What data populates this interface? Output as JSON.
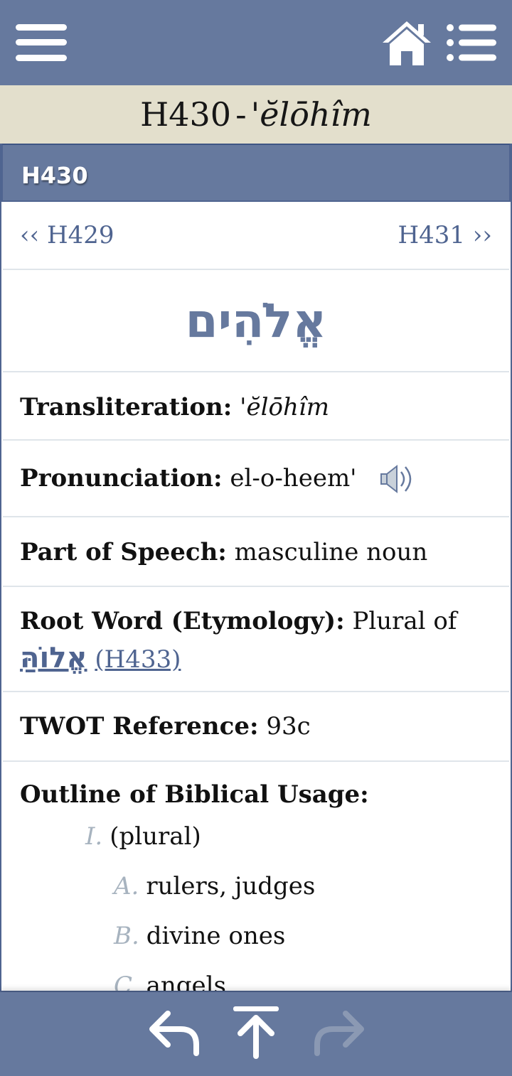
{
  "header": {
    "menu_icon": "hamburger-menu-icon",
    "home_icon": "home-icon",
    "list_icon": "list-icon"
  },
  "title": {
    "code": "H430",
    "separator": "-",
    "translit": "'ĕlōhîm"
  },
  "panel": {
    "header": "H430"
  },
  "nav": {
    "prev": "‹‹ H429",
    "next": "H431 ››"
  },
  "entry": {
    "hebrew": "אֱלֹהִים",
    "transliteration_label": "Transliteration:",
    "transliteration_value": "'ĕlōhîm",
    "pronunciation_label": "Pronunciation:",
    "pronunciation_value": "el-o-heem'",
    "speaker_icon": "speaker-icon",
    "pos_label": "Part of Speech:",
    "pos_value": "masculine noun",
    "root_label": "Root Word (Etymology):",
    "root_text": "Plural of",
    "root_hebrew": "אֱלוֹהַּ",
    "root_ref": "(H433)",
    "twot_label": "TWOT Reference:",
    "twot_value": "93c",
    "outline_label": "Outline of Biblical Usage:",
    "outline": [
      {
        "marker": "I.",
        "text": "(plural)"
      },
      {
        "marker": "A.",
        "text": "rulers, judges"
      },
      {
        "marker": "B.",
        "text": "divine ones"
      },
      {
        "marker": "C.",
        "text": "angels"
      }
    ]
  },
  "footer": {
    "back_icon": "back-arrow-icon",
    "top_icon": "scroll-top-icon",
    "forward_icon": "forward-arrow-icon"
  },
  "colors": {
    "bar": "#66799e",
    "title_bg": "#e3dfcc",
    "link": "#4f6490",
    "divider": "#dfe5ea"
  }
}
